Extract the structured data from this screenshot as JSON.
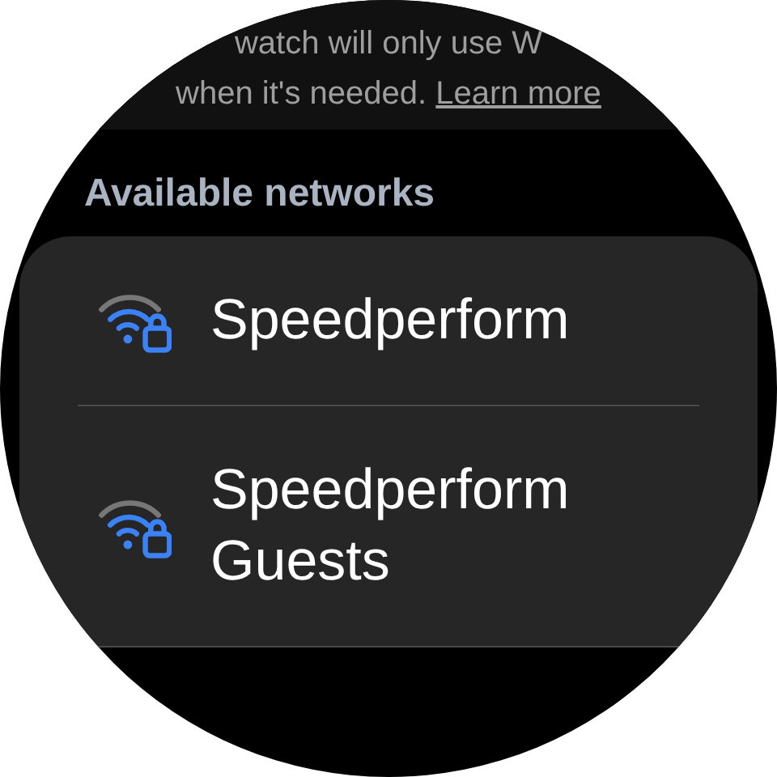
{
  "info": {
    "lines": [
      "watch will only use W",
      "when it's needed."
    ],
    "link": "Learn more"
  },
  "section_title": "Available networks",
  "networks": [
    {
      "name": "Speedperform",
      "secured": true
    },
    {
      "name": "Speedperform Guests",
      "secured": true
    }
  ]
}
